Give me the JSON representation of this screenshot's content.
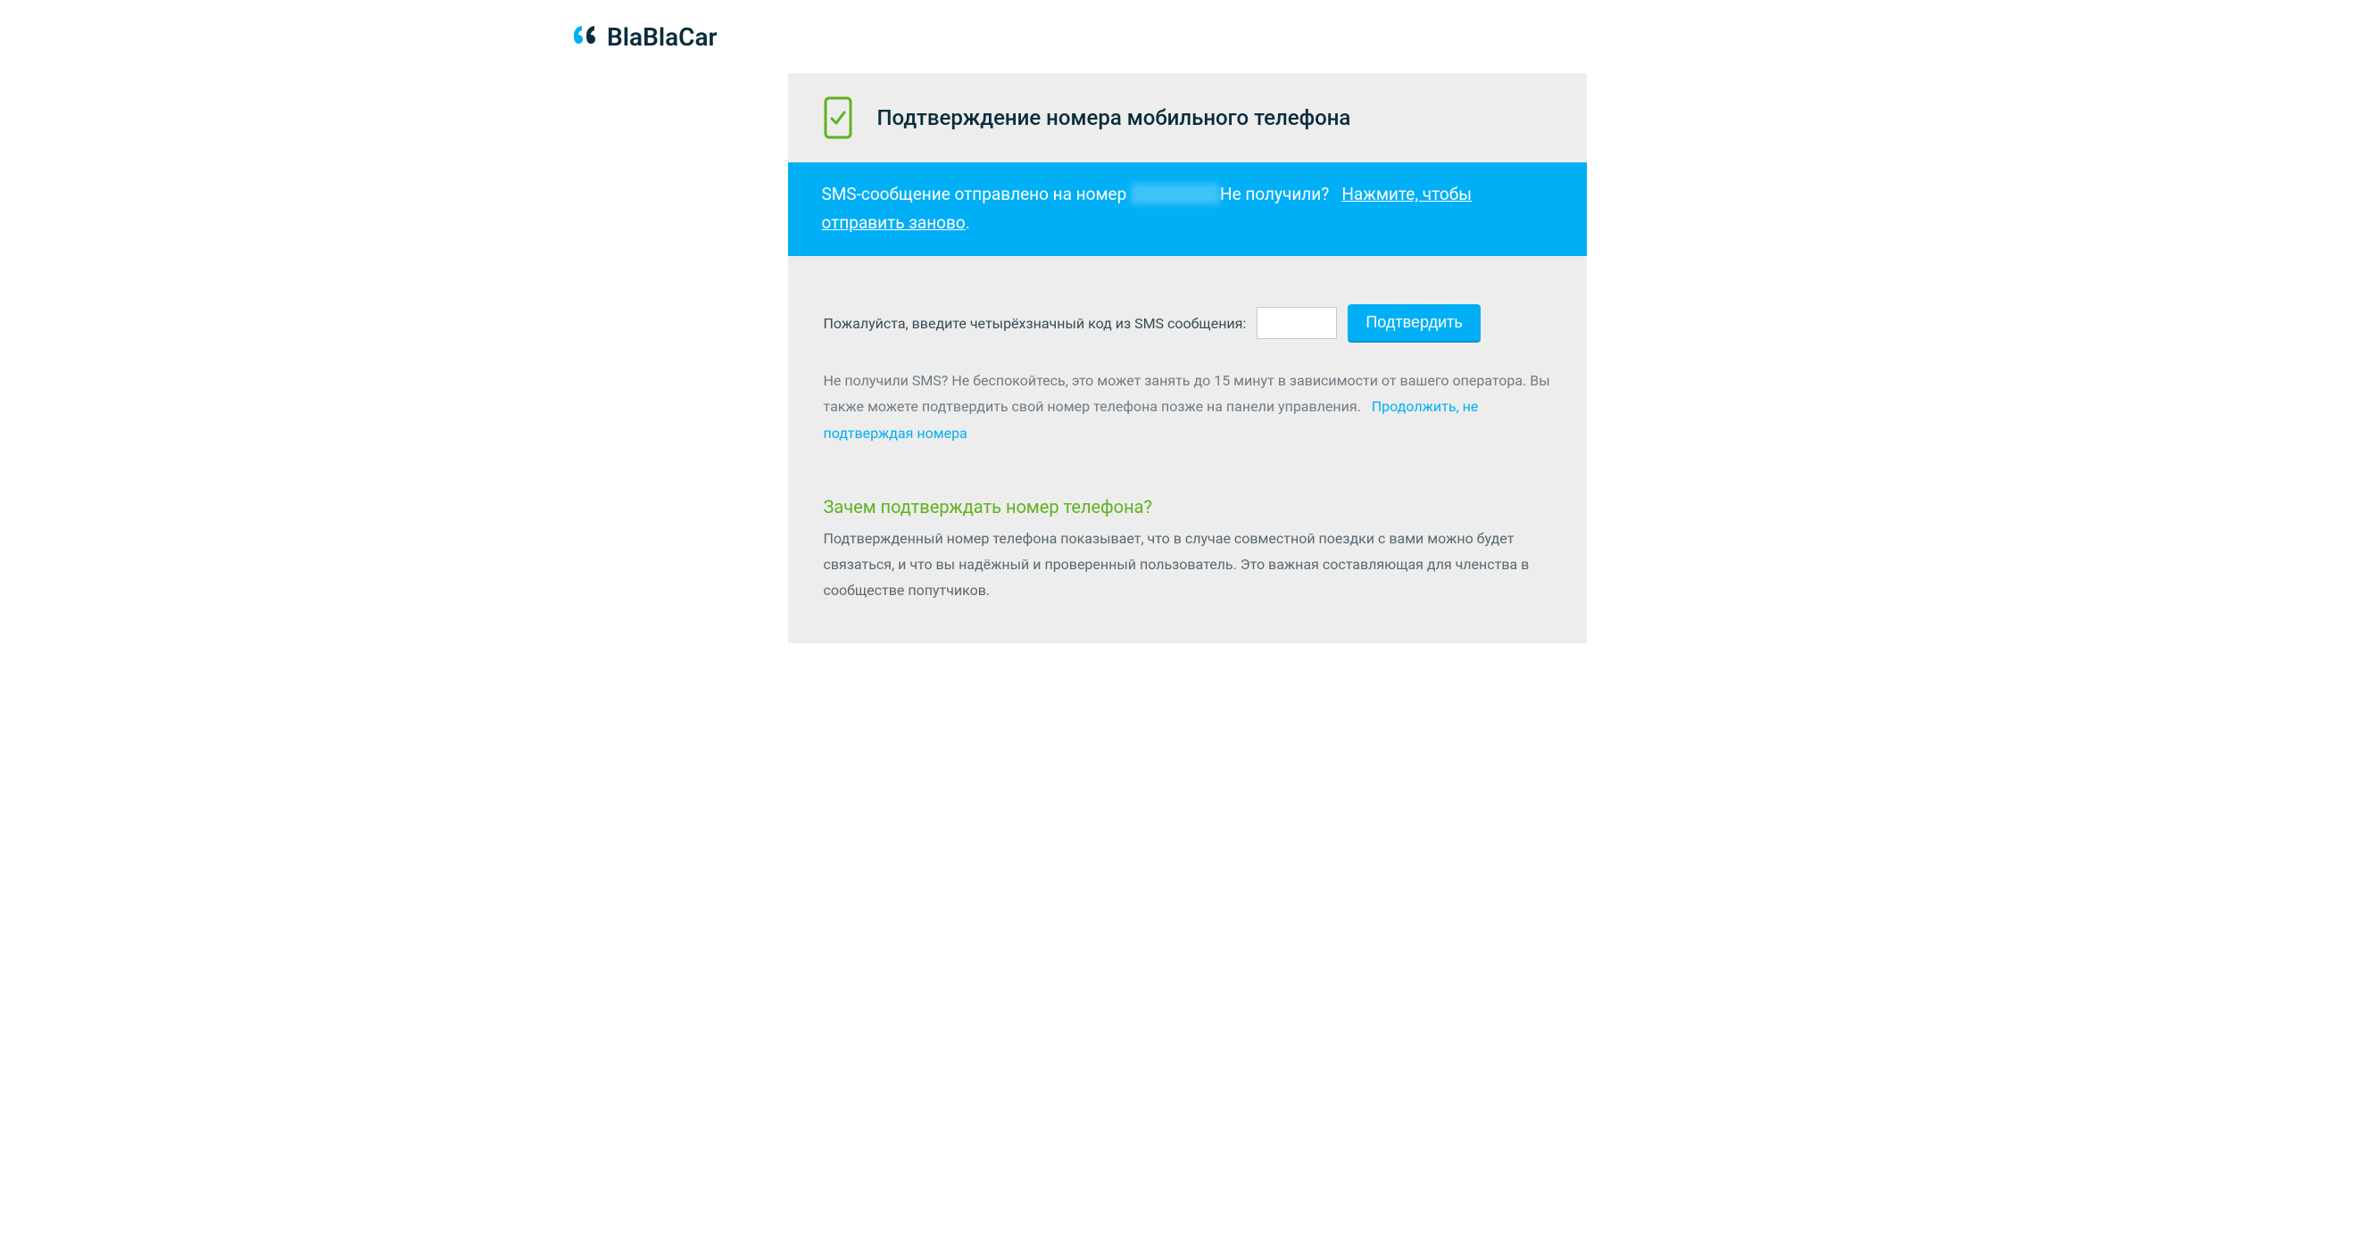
{
  "brand": {
    "name": "BlaBlaCar"
  },
  "card": {
    "title": "Подтверждение номера мобильного телефона"
  },
  "sms": {
    "sent_prefix": "SMS-сообщение отправлено на номер",
    "phone_masked": "",
    "not_received": "Не получили?",
    "resend_link": "Нажмите, чтобы отправить заново",
    "period": "."
  },
  "code": {
    "label": "Пожалуйста, введите четырёхзначный код из SMS сообщения:",
    "confirm_button": "Подтвердить"
  },
  "no_sms": {
    "text": "Не получили SMS? Не беспокойтесь, это может занять до 15 минут в зависимости от вашего оператора. Вы также можете подтвердить свой номер телефона позже на панели управления.",
    "continue_link": "Продолжить, не подтверждая номера"
  },
  "why": {
    "title": "Зачем подтверждать номер телефона?",
    "text": "Подтвержденный номер телефона показывает, что в случае совместной поездки с вами можно будет связаться, и что вы надёжный и проверенный пользователь. Это важная составляющая для членства в сообществе попутчиков."
  }
}
